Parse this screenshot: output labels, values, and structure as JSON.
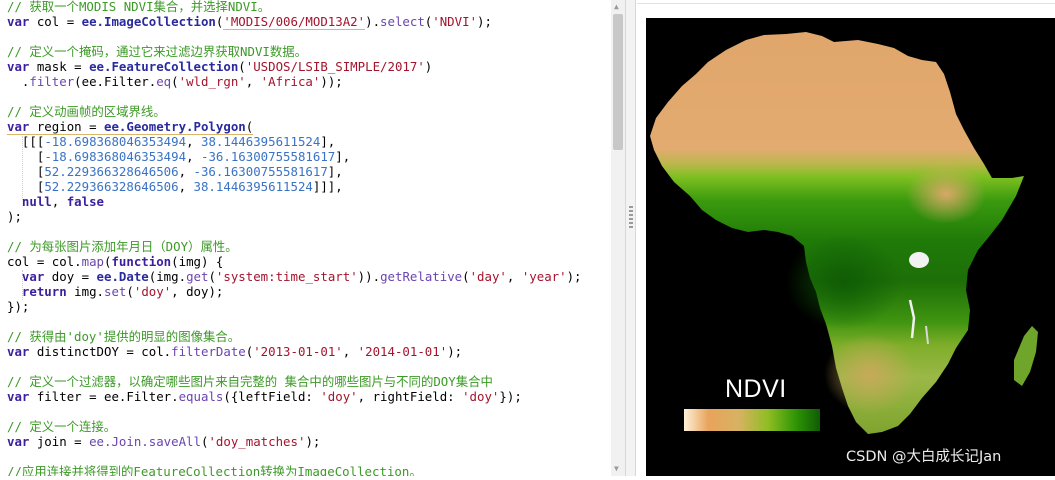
{
  "editor": {
    "lines": [
      [
        {
          "t": "// 获取一个MODIS NDVI集合，并选择NDVI。",
          "c": "cm"
        }
      ],
      [
        {
          "t": "var",
          "c": "kw"
        },
        {
          "t": " col = "
        },
        {
          "t": "ee.ImageCollection",
          "c": "ee"
        },
        {
          "t": "("
        },
        {
          "t": "'MODIS/006/MOD13A2'",
          "c": "st ul"
        },
        {
          "t": ")."
        },
        {
          "t": "select",
          "c": "fn"
        },
        {
          "t": "("
        },
        {
          "t": "'NDVI'",
          "c": "st"
        },
        {
          "t": ");"
        }
      ],
      [],
      [
        {
          "t": "// 定义一个掩码，通过它来过滤边界获取NDVI数据。",
          "c": "cm"
        }
      ],
      [
        {
          "t": "var",
          "c": "kw"
        },
        {
          "t": " mask = "
        },
        {
          "t": "ee.FeatureCollection",
          "c": "ee"
        },
        {
          "t": "("
        },
        {
          "t": "'USDOS/LSIB_SIMPLE/2017'",
          "c": "st"
        },
        {
          "t": ")"
        }
      ],
      [
        {
          "t": "  ."
        },
        {
          "t": "filter",
          "c": "fn"
        },
        {
          "t": "(ee.Filter."
        },
        {
          "t": "eq",
          "c": "fn"
        },
        {
          "t": "("
        },
        {
          "t": "'wld_rgn'",
          "c": "st"
        },
        {
          "t": ", "
        },
        {
          "t": "'Africa'",
          "c": "st"
        },
        {
          "t": "));"
        }
      ],
      [],
      [
        {
          "t": "// 定义动画帧的区域界线。",
          "c": "cm"
        }
      ],
      [
        {
          "t": "var",
          "c": "kw ul"
        },
        {
          "t": " region = ",
          "c": "ul"
        },
        {
          "t": "ee.Geometry.Polygon",
          "c": "ee ul"
        },
        {
          "t": "(",
          "c": "ul"
        }
      ],
      [
        {
          "t": "  [[["
        },
        {
          "t": "-18.698368046353494",
          "c": "nm"
        },
        {
          "t": ", "
        },
        {
          "t": "38.1446395611524",
          "c": "nm"
        },
        {
          "t": "],"
        }
      ],
      [
        {
          "t": "    ["
        },
        {
          "t": "-18.698368046353494",
          "c": "nm"
        },
        {
          "t": ", "
        },
        {
          "t": "-36.16300755581617",
          "c": "nm"
        },
        {
          "t": "],"
        }
      ],
      [
        {
          "t": "    ["
        },
        {
          "t": "52.229366328646506",
          "c": "nm"
        },
        {
          "t": ", "
        },
        {
          "t": "-36.16300755581617",
          "c": "nm"
        },
        {
          "t": "],"
        }
      ],
      [
        {
          "t": "    ["
        },
        {
          "t": "52.229366328646506",
          "c": "nm"
        },
        {
          "t": ", "
        },
        {
          "t": "38.1446395611524",
          "c": "nm"
        },
        {
          "t": "]]],"
        }
      ],
      [
        {
          "t": "  "
        },
        {
          "t": "null",
          "c": "kw"
        },
        {
          "t": ", "
        },
        {
          "t": "false",
          "c": "kw"
        }
      ],
      [
        {
          "t": ");"
        }
      ],
      [],
      [
        {
          "t": "// 为每张图片添加年月日（DOY）属性。",
          "c": "cm"
        }
      ],
      [
        {
          "t": "col = col."
        },
        {
          "t": "map",
          "c": "fn"
        },
        {
          "t": "("
        },
        {
          "t": "function",
          "c": "kw"
        },
        {
          "t": "(img) {"
        }
      ],
      [
        {
          "t": "  "
        },
        {
          "t": "var",
          "c": "kw"
        },
        {
          "t": " doy = "
        },
        {
          "t": "ee.Date",
          "c": "ee"
        },
        {
          "t": "(img."
        },
        {
          "t": "get",
          "c": "fn"
        },
        {
          "t": "("
        },
        {
          "t": "'system:time_start'",
          "c": "st"
        },
        {
          "t": "))."
        },
        {
          "t": "getRelative",
          "c": "fn"
        },
        {
          "t": "("
        },
        {
          "t": "'day'",
          "c": "st"
        },
        {
          "t": ", "
        },
        {
          "t": "'year'",
          "c": "st"
        },
        {
          "t": ");"
        }
      ],
      [
        {
          "t": "  "
        },
        {
          "t": "return",
          "c": "kw"
        },
        {
          "t": " img."
        },
        {
          "t": "set",
          "c": "fn"
        },
        {
          "t": "("
        },
        {
          "t": "'doy'",
          "c": "st"
        },
        {
          "t": ", doy);"
        }
      ],
      [
        {
          "t": "});"
        }
      ],
      [],
      [
        {
          "t": "// 获得由'doy'提供的明显的图像集合。",
          "c": "cm"
        }
      ],
      [
        {
          "t": "var",
          "c": "kw"
        },
        {
          "t": " distinctDOY = col."
        },
        {
          "t": "filterDate",
          "c": "fn"
        },
        {
          "t": "("
        },
        {
          "t": "'2013-01-01'",
          "c": "st"
        },
        {
          "t": ", "
        },
        {
          "t": "'2014-01-01'",
          "c": "st"
        },
        {
          "t": ");"
        }
      ],
      [],
      [
        {
          "t": "// 定义一个过滤器，以确定哪些图片来自完整的 集合中的哪些图片与不同的DOY集合中",
          "c": "cm"
        }
      ],
      [
        {
          "t": "var",
          "c": "kw"
        },
        {
          "t": " filter = ee.Filter."
        },
        {
          "t": "equals",
          "c": "fn"
        },
        {
          "t": "({leftField: "
        },
        {
          "t": "'doy'",
          "c": "st"
        },
        {
          "t": ", rightField: "
        },
        {
          "t": "'doy'",
          "c": "st"
        },
        {
          "t": "});"
        }
      ],
      [],
      [
        {
          "t": "// 定义一个连接。",
          "c": "cm"
        }
      ],
      [
        {
          "t": "var",
          "c": "kw"
        },
        {
          "t": " join = "
        },
        {
          "t": "ee.Join.saveAll",
          "c": "fn"
        },
        {
          "t": "("
        },
        {
          "t": "'doy_matches'",
          "c": "st"
        },
        {
          "t": ");"
        }
      ],
      [],
      [
        {
          "t": "//应用连接并将得到的FeatureCollection转换为ImageCollection。",
          "c": "cm"
        }
      ]
    ]
  },
  "viewer": {
    "legend_title": "NDVI",
    "watermark": "CSDN @大白成长记Jan",
    "colors": {
      "background": "#000000",
      "desert": "#dfa46a",
      "sahel": "#9cc52c",
      "forest": "#1a6d07"
    }
  }
}
